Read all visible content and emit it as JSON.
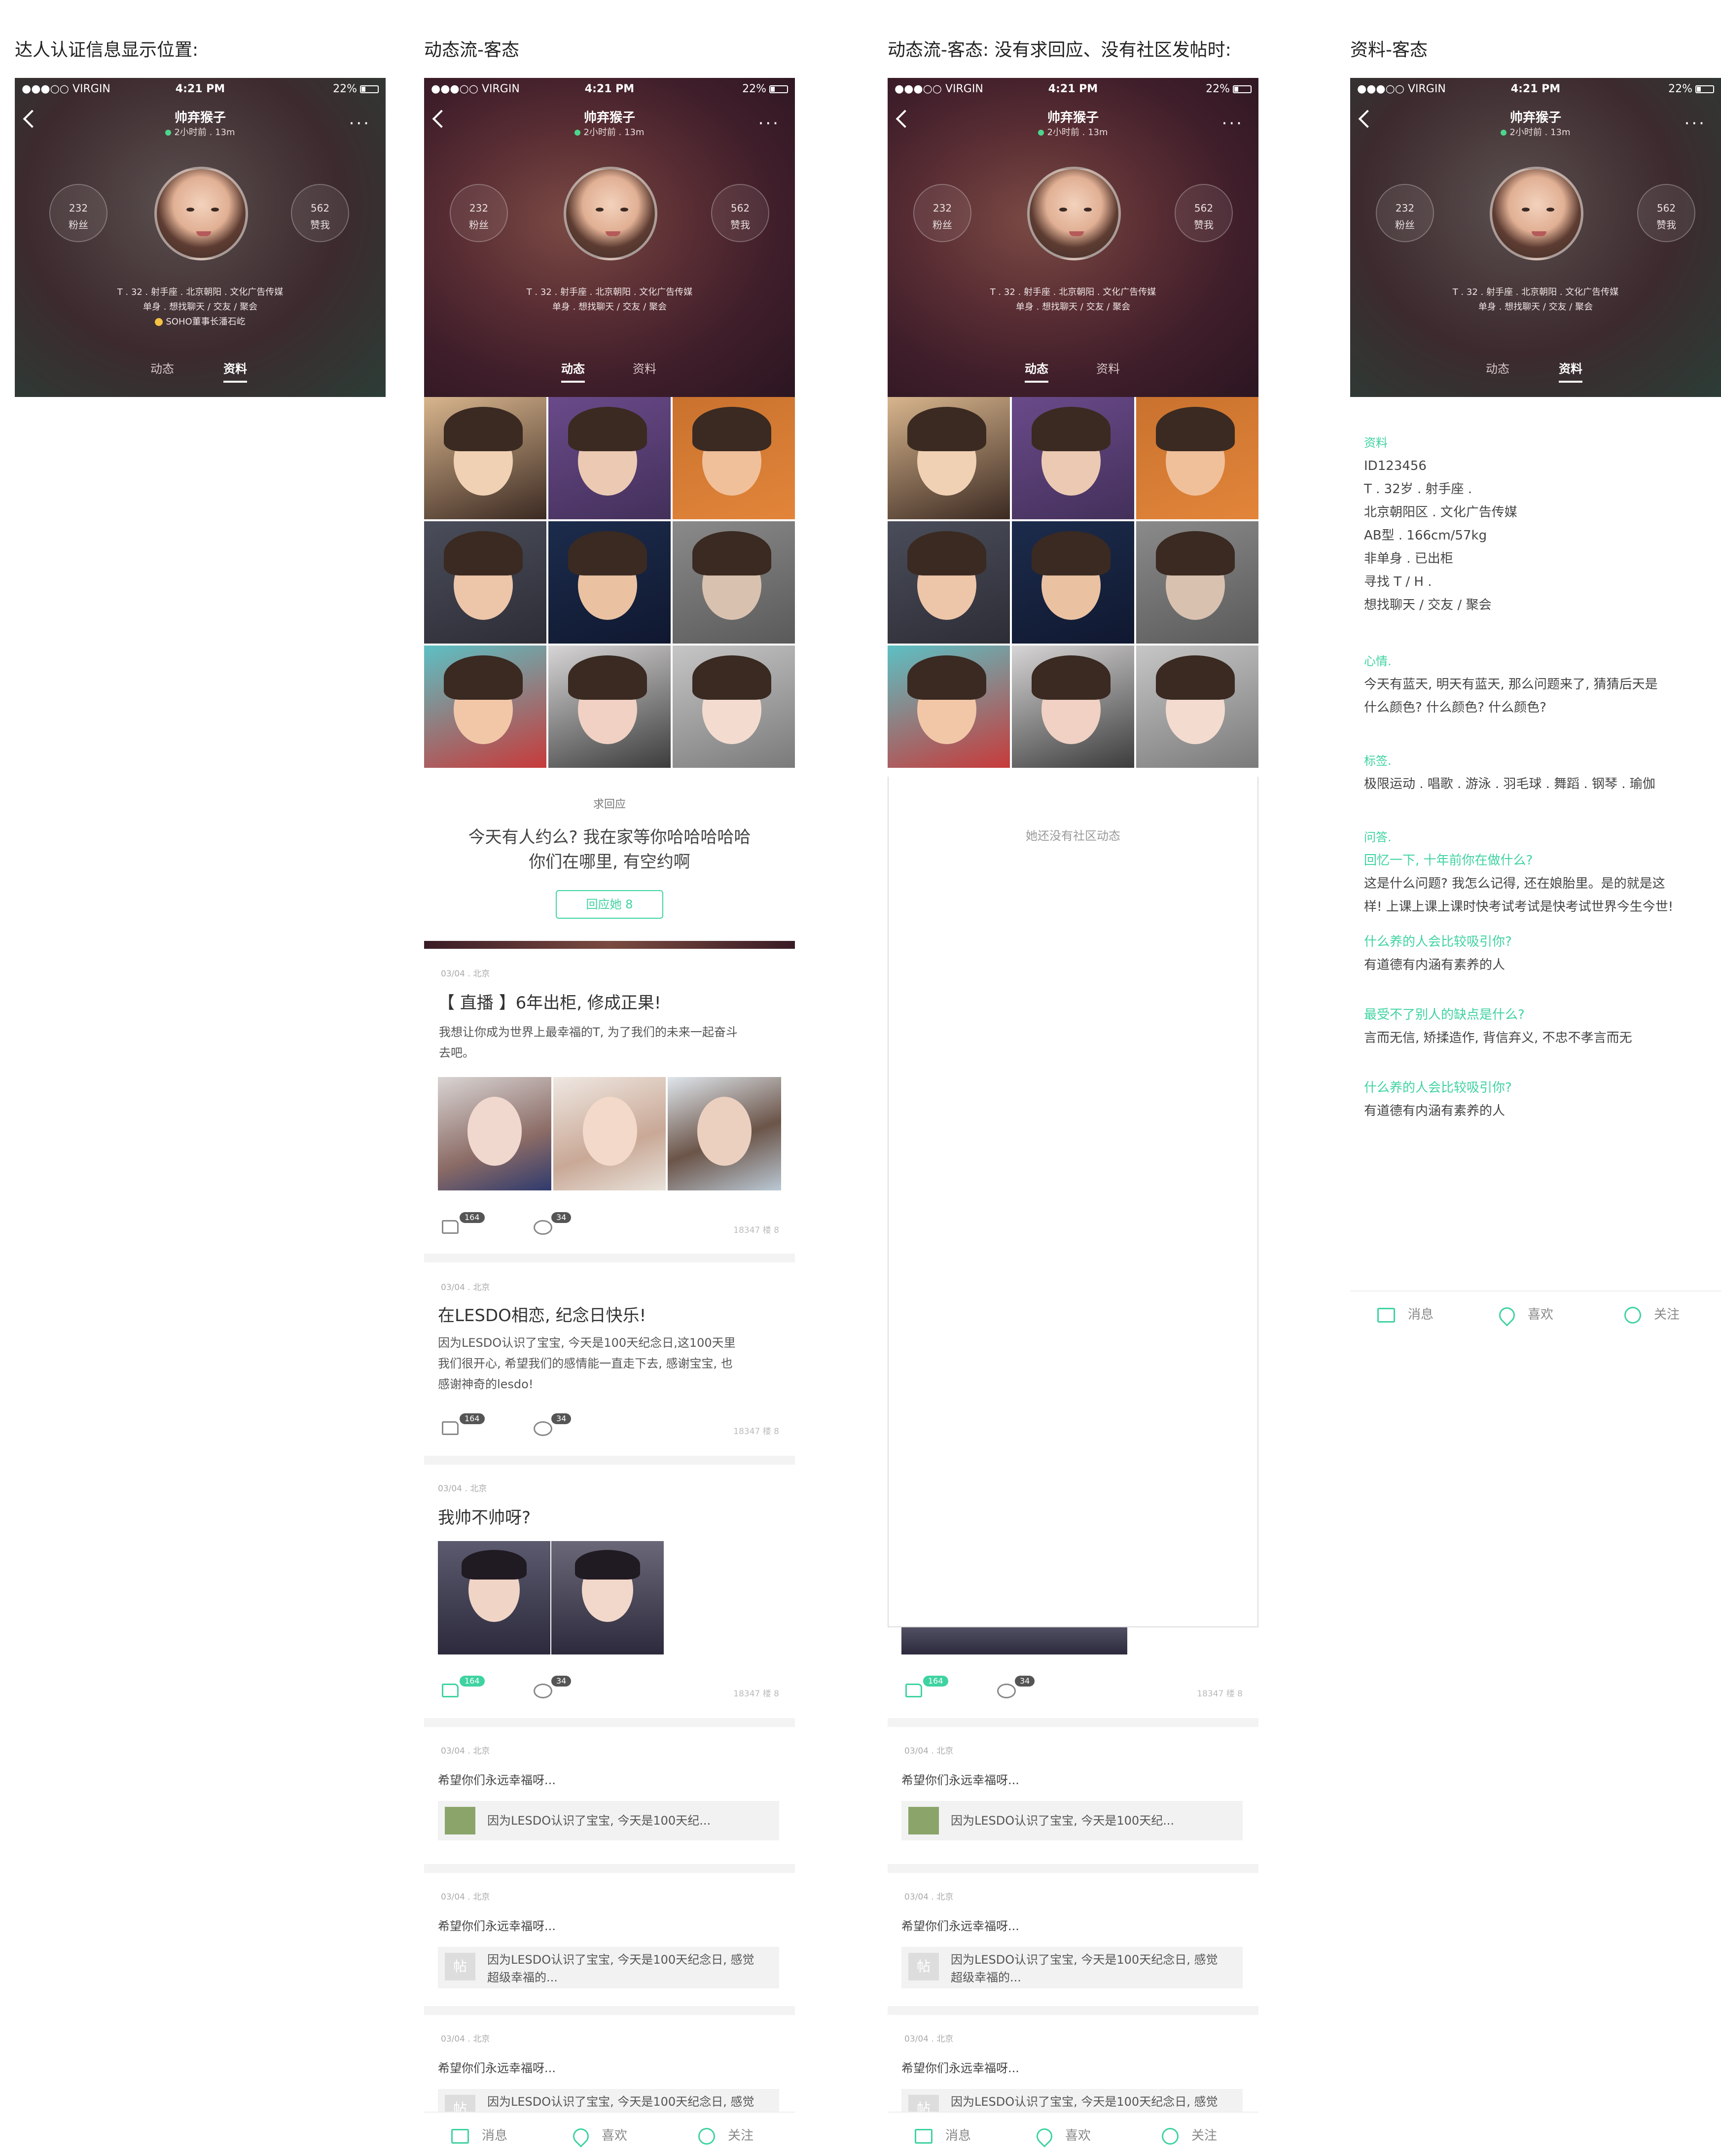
{
  "captions": {
    "c1": "达人认证信息显示位置:",
    "c2": "动态流-客态",
    "c3": "动态流-客态: 没有求回应、没有社区发帖时:",
    "c4": "资料-客态"
  },
  "status": {
    "carrier": "●●●○○ VIRGIN",
    "time": "4:21 PM",
    "battery": "22%"
  },
  "profile": {
    "name": "帅弃猴子",
    "online": "2小时前 . 13m",
    "fans_count": "232",
    "fans_label": "粉丝",
    "likes_count": "562",
    "likes_label": "赞我",
    "bio_line1": "T . 32 . 射手座 . 北京朝阳 . 文化广告传媒",
    "bio_line2": "单身 . 想找聊天 / 交友 / 聚会",
    "cert": "SOHO董事长潘石屹",
    "tab_feed": "动态",
    "tab_info": "资料"
  },
  "feed": {
    "request_label": "求回应",
    "request_text1": "今天有人约么? 我在家等你哈哈哈哈哈",
    "request_text2": "你们在哪里, 有空约啊",
    "reply_button": "回应她  8",
    "empty_text": "她还没有社区动态",
    "posts": [
      {
        "meta": "03/04 . 北京",
        "title": "【 直播 】6年出柜, 修成正果!",
        "text1": "我想让你成为世界上最幸福的T, 为了我们的未来一起奋斗",
        "text2": "去吧。",
        "likes": "164",
        "comments": "34",
        "views": "18347   楼 8"
      },
      {
        "meta": "03/04 . 北京",
        "title": "在LESDO相恋, 纪念日快乐!",
        "text1": "因为LESDO认识了宝宝, 今天是100天纪念日,这100天里",
        "text2": "我们很开心, 希望我们的感情能一直走下去, 感谢宝宝, 也",
        "text3": "感谢神奇的lesdo!",
        "likes": "164",
        "comments": "34",
        "views": "18347   楼 8"
      },
      {
        "meta": "03/04 . 北京",
        "title": "我帅不帅呀?",
        "likes": "164",
        "comments": "34",
        "views": "18347   楼 8"
      }
    ],
    "reposts": [
      {
        "meta": "03/04 . 北京",
        "text": "希望你们永远幸福呀...",
        "quote": "因为LESDO认识了宝宝, 今天是100天纪..."
      },
      {
        "meta": "03/04 . 北京",
        "text": "希望你们永远幸福呀...",
        "quote1": "因为LESDO认识了宝宝, 今天是100天纪念日, 感觉",
        "quote2": "超级幸福的...",
        "thumb": "帖"
      },
      {
        "meta": "03/04 . 北京",
        "text": "希望你们永远幸福呀...",
        "quote1": "因为LESDO认识了宝宝, 今天是100天纪念日, 感觉",
        "thumb": "帖"
      }
    ]
  },
  "info": {
    "sec1": "资料",
    "id": "ID123456",
    "l1": "T . 32岁 . 射手座 .",
    "l2": "北京朝阳区 . 文化广告传媒",
    "l3": "AB型 . 166cm/57kg",
    "l4": "非单身 . 已出柜",
    "l5": "寻找 T / H .",
    "l6": "想找聊天 / 交友 / 聚会",
    "sec2": "心情.",
    "mood1": "今天有蓝天, 明天有蓝天, 那么问题来了, 猜猜后天是",
    "mood2": "什么颜色? 什么颜色? 什么颜色?",
    "sec3": "标签.",
    "tags": "极限运动 . 唱歌 . 游泳 . 羽毛球 . 舞蹈 . 钢琴 . 瑜伽",
    "sec4": "问答.",
    "q1": "回忆一下, 十年前你在做什么?",
    "a1_1": "这是什么问题? 我怎么记得, 还在娘胎里。是的就是这",
    "a1_2": "样! 上课上课上课时快考试考试是快考试世界今生今世!",
    "q2": "什么养的人会比较吸引你?",
    "a2": "有道德有内涵有素养的人",
    "q3": "最受不了别人的缺点是什么?",
    "a3": "言而无信, 矫揉造作, 背信弃义, 不忠不孝言而无",
    "q4": "什么养的人会比较吸引你?",
    "a4": "有道德有内涵有素养的人"
  },
  "bottombar": {
    "msg": "消息",
    "like": "喜欢",
    "follow": "关注"
  },
  "colors": {
    "accent": "#3fd3a0"
  }
}
